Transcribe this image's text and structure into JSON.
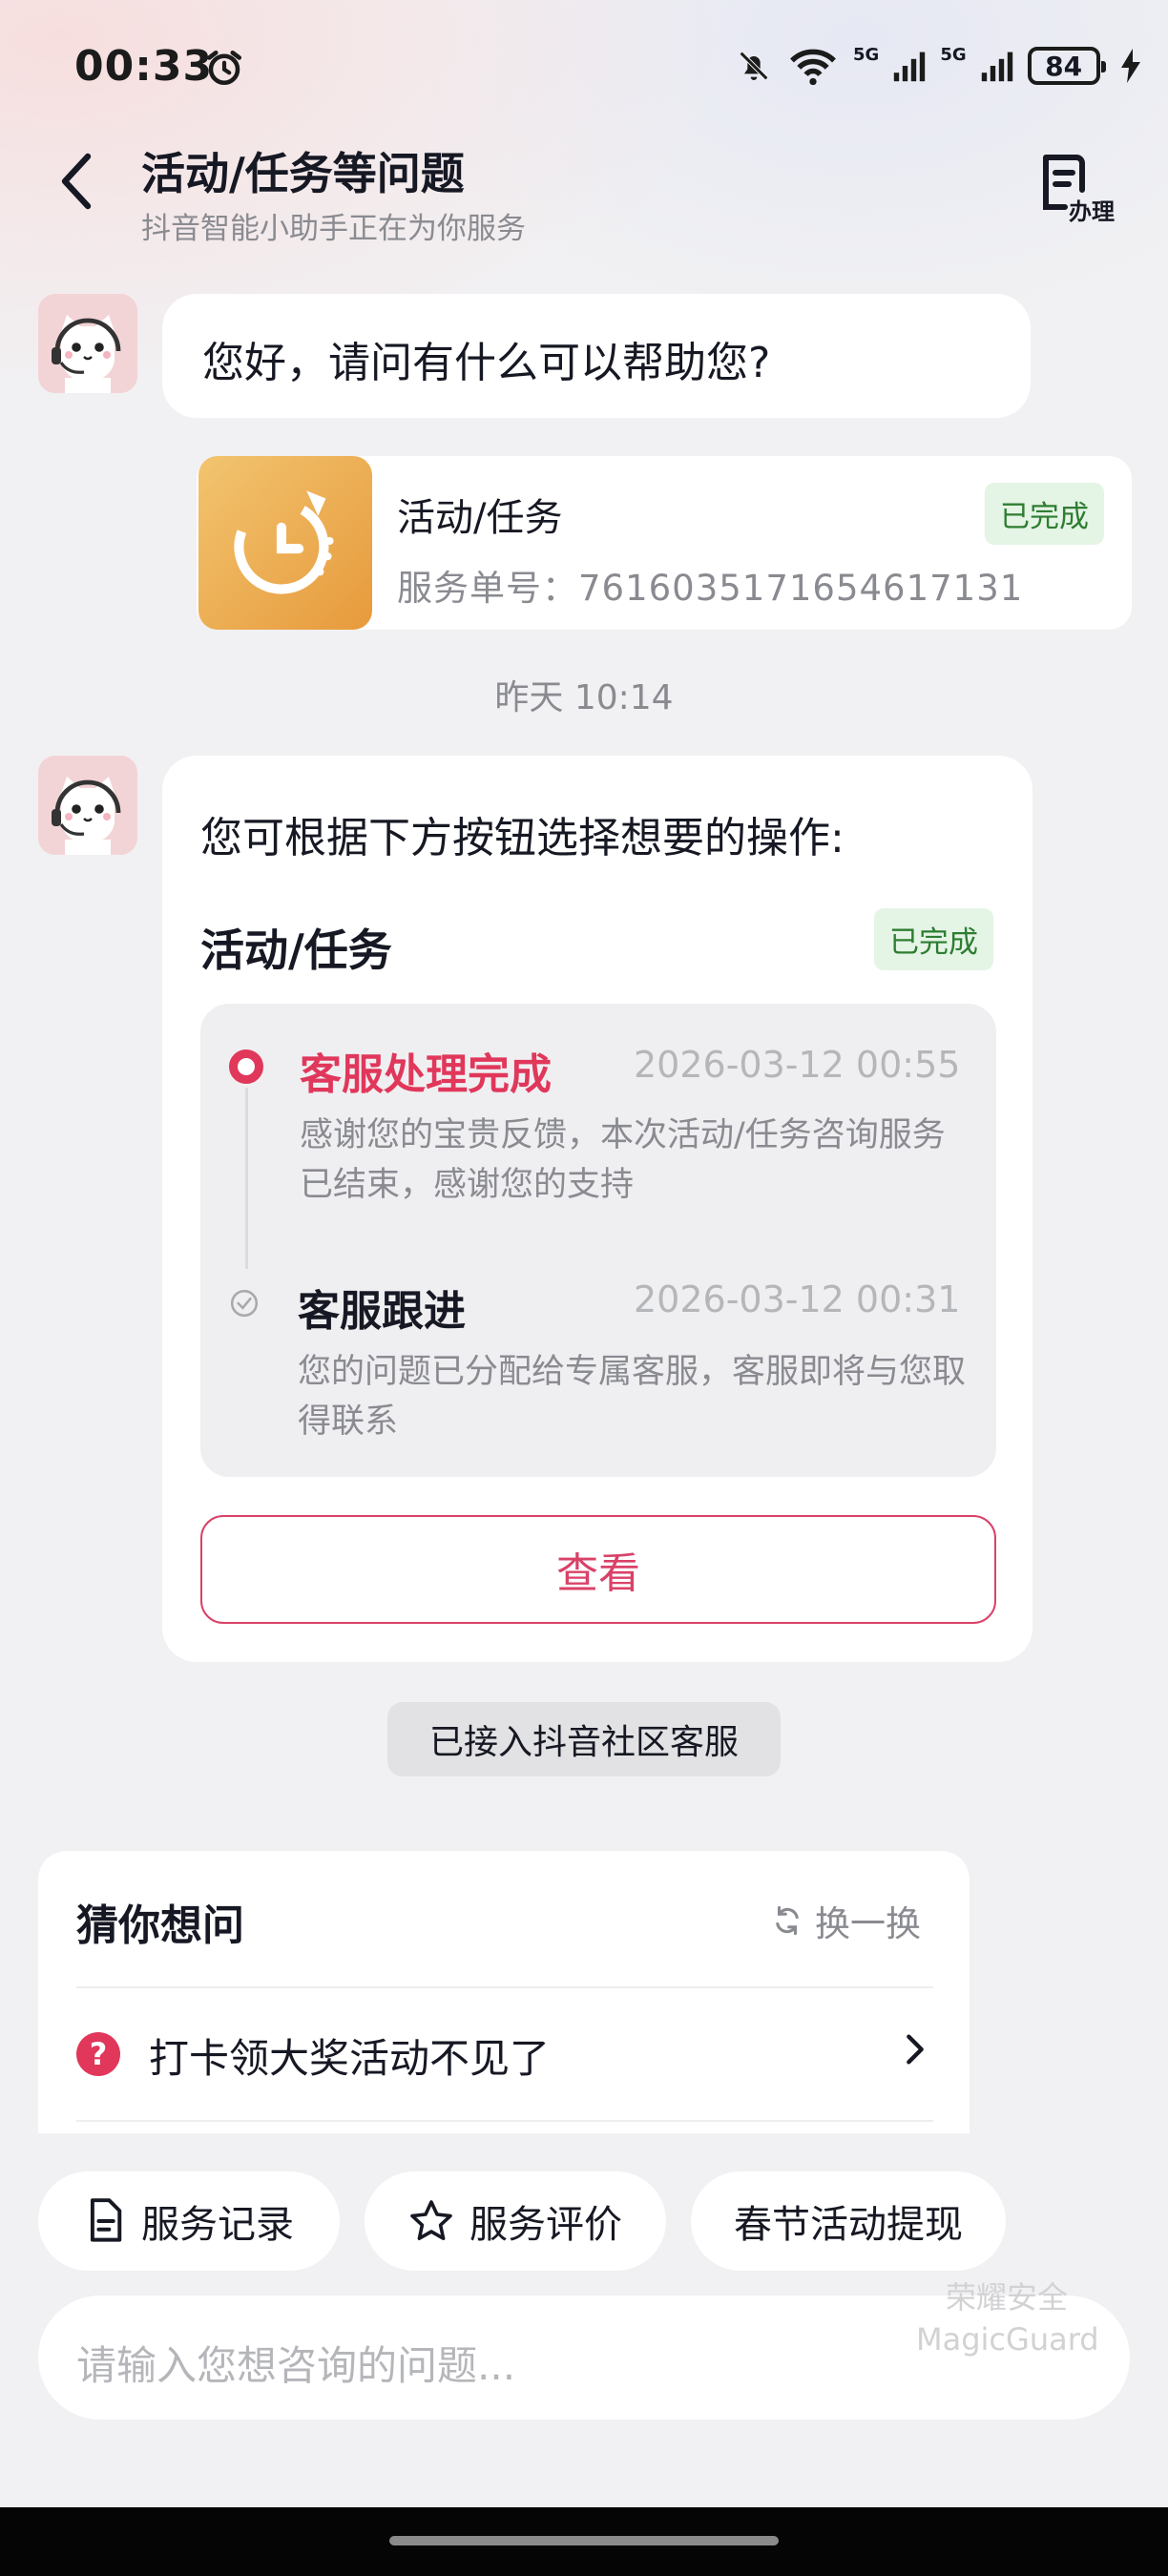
{
  "status_bar": {
    "time": "00:33",
    "signal_1": "5G",
    "signal_2": "5G",
    "battery": "84"
  },
  "header": {
    "title": "活动/任务等问题",
    "subtitle": "抖音智能小助手正在为你服务",
    "action_label": "办理"
  },
  "chat": {
    "greeting": "您好，请问有什么可以帮助您?",
    "order_card": {
      "title": "活动/任务",
      "status": "已完成",
      "order_number": "服务单号：7616035171654617131"
    },
    "time_separator": "昨天 10:14",
    "message": {
      "prompt": "您可根据下方按钮选择想要的操作:",
      "card_title": "活动/任务",
      "status": "已完成",
      "timeline": [
        {
          "title": "客服处理完成",
          "time": "2026-03-12 00:55",
          "description": "感谢您的宝贵反馈，本次活动/任务咨询服务已结束，感谢您的支持"
        },
        {
          "title": "客服跟进",
          "time": "2026-03-12 00:31",
          "description": "您的问题已分配给专属客服，客服即将与您取得联系"
        }
      ],
      "view_button": "查看"
    },
    "system_notice": "已接入抖音社区客服"
  },
  "suggestions": {
    "title": "猜你想问",
    "refresh_label": "换一换",
    "items": [
      "打卡领大奖活动不见了"
    ]
  },
  "chips": [
    "服务记录",
    "服务评价",
    "春节活动提现"
  ],
  "input": {
    "placeholder": "请输入您想咨询的问题..."
  },
  "watermark": {
    "line1": "荣耀安全",
    "line2": "MagicGuard"
  },
  "colors": {
    "accent": "#e0375b",
    "done_badge_bg": "#e4f4e5",
    "done_badge_text": "#2e7d32",
    "background": "#f1f1f3"
  }
}
